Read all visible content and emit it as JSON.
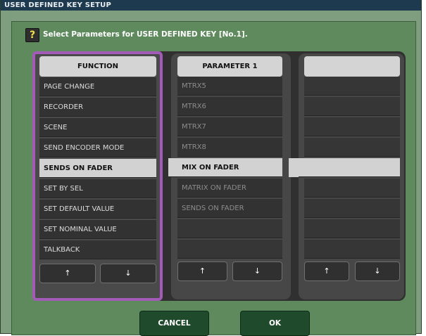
{
  "window": {
    "title": "USER DEFINED KEY SETUP"
  },
  "help": {
    "icon": "question-icon",
    "glyph": "?",
    "text": "Select Parameters for USER DEFINED KEY [No.1]."
  },
  "function_list": {
    "header": "FUNCTION",
    "items": [
      "PAGE CHANGE",
      "RECORDER",
      "SCENE",
      "SEND ENCODER MODE",
      "SENDS ON FADER",
      "SET BY SEL",
      "SET DEFAULT VALUE",
      "SET NOMINAL VALUE",
      "TALKBACK"
    ],
    "selected_index": 4
  },
  "parameter1_list": {
    "header": "PARAMETER 1",
    "items": [
      "MTRX5",
      "MTRX6",
      "MTRX7",
      "MTRX8",
      "MIX ON FADER",
      "MATRIX ON FADER",
      "SENDS ON FADER",
      "",
      ""
    ],
    "selected_index": 4
  },
  "parameter2_list": {
    "header": "",
    "items": [
      "",
      "",
      "",
      "",
      "",
      "",
      "",
      "",
      ""
    ],
    "selected_index": 4
  },
  "scroll_buttons": {
    "up": "↑",
    "down": "↓"
  },
  "buttons": {
    "cancel": "CANCEL",
    "ok": "OK"
  },
  "colors": {
    "title_bar": "#1e3a4e",
    "dialog_bg": "#5e8a5e",
    "selection_frame": "#a45ab8",
    "selected_row": "#d2d2d2",
    "ok_cancel_bg": "#1f4a2c"
  }
}
